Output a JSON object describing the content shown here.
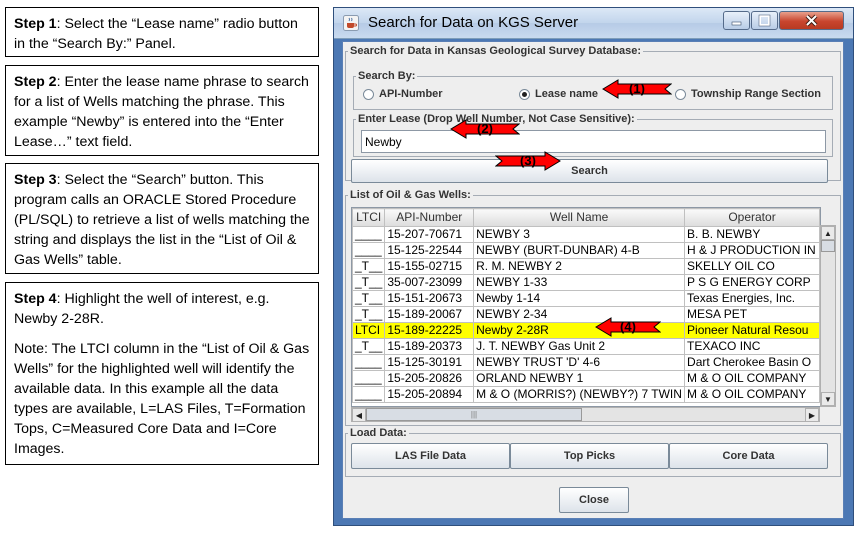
{
  "steps": [
    {
      "title": "Step 1",
      "text": ": Select the “Lease name” radio button in the “Search By:” Panel."
    },
    {
      "title": "Step 2",
      "text": ": Enter the lease name phrase to search  for a list of Wells matching the phrase. This example “Newby” is entered into the “Enter Lease…” text field."
    },
    {
      "title": "Step 3",
      "text": ": Select the “Search” button.  This program calls an ORACLE Stored Procedure (PL/SQL) to retrieve a list of wells matching the string and displays the list in the “List of Oil & Gas Wells” table."
    },
    {
      "title": "Step 4",
      "text": ": Highlight the well of interest, e.g. Newby 2-28R.",
      "note": "Note: The LTCI column in the “List of Oil & Gas Wells” for the highlighted well will identify the available data. In this example all the data types are available, L=LAS Files, T=Formation Tops, C=Measured Core Data and I=Core Images."
    }
  ],
  "window": {
    "title": "Search for Data on KGS Server",
    "search_group_label": "Search for Data in Kansas Geological Survey Database:",
    "search_by": {
      "label": "Search By:",
      "options": [
        "API-Number",
        "Lease name",
        "Township Range Section"
      ],
      "selected": "Lease name"
    },
    "lease": {
      "label": "Enter Lease (Drop Well Number, Not Case Sensitive):",
      "value": "Newby"
    },
    "search_button": "Search",
    "wells_group_label": "List of Oil & Gas Wells:",
    "columns": [
      "LTCI",
      "API-Number",
      "Well Name",
      "Operator"
    ],
    "rows": [
      [
        "____",
        "15-207-70671",
        "NEWBY 3",
        "B. B. NEWBY"
      ],
      [
        "____",
        "15-125-22544",
        "NEWBY (BURT-DUNBAR) 4-B",
        "H & J PRODUCTION IN"
      ],
      [
        "_T__",
        "15-155-02715",
        "R. M. NEWBY 2",
        "SKELLY OIL CO"
      ],
      [
        "_T__",
        "35-007-23099",
        "NEWBY 1-33",
        "P S G ENERGY CORP"
      ],
      [
        "_T__",
        "15-151-20673",
        "Newby 1-14",
        "Texas Energies, Inc."
      ],
      [
        "_T__",
        "15-189-20067",
        "NEWBY 2-34",
        "MESA PET"
      ],
      [
        "LTCI",
        "15-189-22225",
        "Newby 2-28R",
        "Pioneer Natural Resou"
      ],
      [
        "_T__",
        "15-189-20373",
        "J. T. NEWBY Gas Unit 2",
        "TEXACO INC"
      ],
      [
        "____",
        "15-125-30191",
        "NEWBY TRUST 'D' 4-6",
        "Dart Cherokee Basin O"
      ],
      [
        "____",
        "15-205-20826",
        "ORLAND NEWBY 1",
        "M & O OIL COMPANY"
      ],
      [
        "____",
        "15-205-20894",
        "M & O (MORRIS?) (NEWBY?) 7 TWIN",
        "M & O OIL COMPANY"
      ]
    ],
    "highlighted_row": 6,
    "load_group_label": "Load Data:",
    "load_buttons": [
      "LAS File Data",
      "Top Picks",
      "Core Data"
    ],
    "close_button": "Close"
  },
  "callouts": [
    "(1)",
    "(2)",
    "(3)",
    "(4)"
  ],
  "colors": {
    "callout_fill": "#ff0000",
    "highlight_row": "#ffff00",
    "window_frame": "#4c78b4"
  }
}
